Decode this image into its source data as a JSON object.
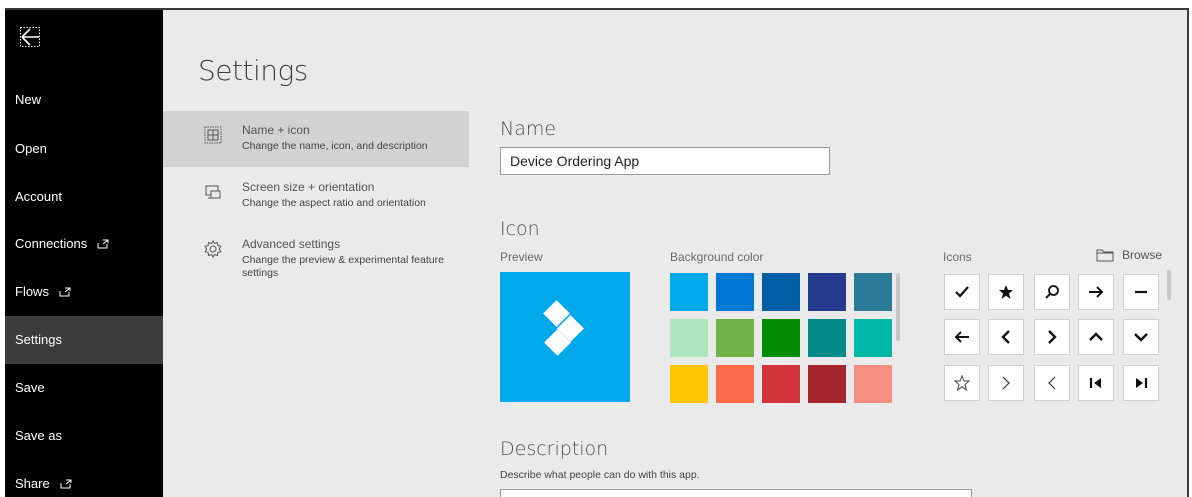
{
  "nav": {
    "items": [
      {
        "label": "New"
      },
      {
        "label": "Open"
      },
      {
        "label": "Account"
      },
      {
        "label": "Connections"
      },
      {
        "label": "Flows"
      },
      {
        "label": "Settings"
      },
      {
        "label": "Save"
      },
      {
        "label": "Save as"
      },
      {
        "label": "Share"
      }
    ],
    "active": "Settings"
  },
  "page": {
    "title": "Settings"
  },
  "subnav": {
    "items": [
      {
        "title": "Name + icon",
        "desc": "Change the name, icon, and description",
        "icon": "grid-icon"
      },
      {
        "title": "Screen size + orientation",
        "desc": "Change the aspect ratio and orientation",
        "icon": "screen-orientation-icon"
      },
      {
        "title": "Advanced settings",
        "desc": "Change the preview & experimental feature settings",
        "icon": "gear-icon"
      }
    ]
  },
  "name_section": {
    "heading": "Name",
    "value": "Device Ordering App"
  },
  "icon_section": {
    "heading": "Icon",
    "preview_label": "Preview",
    "preview_color": "#00a9eb",
    "bg_label": "Background color",
    "colors": [
      [
        "#00a9eb",
        "#0078d4",
        "#005ea6",
        "#243a8c",
        "#2b7c99"
      ],
      [
        "#ade5bd",
        "#70b245",
        "#008c00",
        "#008b8b",
        "#00b8a6"
      ],
      [
        "#ffc300",
        "#ff6b4a",
        "#d13438",
        "#a4262c",
        "#f48e80"
      ]
    ],
    "icons_label": "Icons",
    "browse_label": "Browse",
    "icons": [
      [
        "check-icon",
        "star-icon",
        "search-icon",
        "arrow-right-icon",
        "minus-icon"
      ],
      [
        "arrow-left-icon",
        "chevron-left-icon",
        "chevron-right-icon",
        "chevron-up-icon",
        "chevron-down-icon"
      ],
      [
        "star-outline-icon",
        "chevron-right-thin-icon",
        "chevron-left-thin-icon",
        "skip-first-icon",
        "skip-last-icon"
      ]
    ]
  },
  "description_section": {
    "heading": "Description",
    "hint": "Describe what people can do with this app."
  }
}
